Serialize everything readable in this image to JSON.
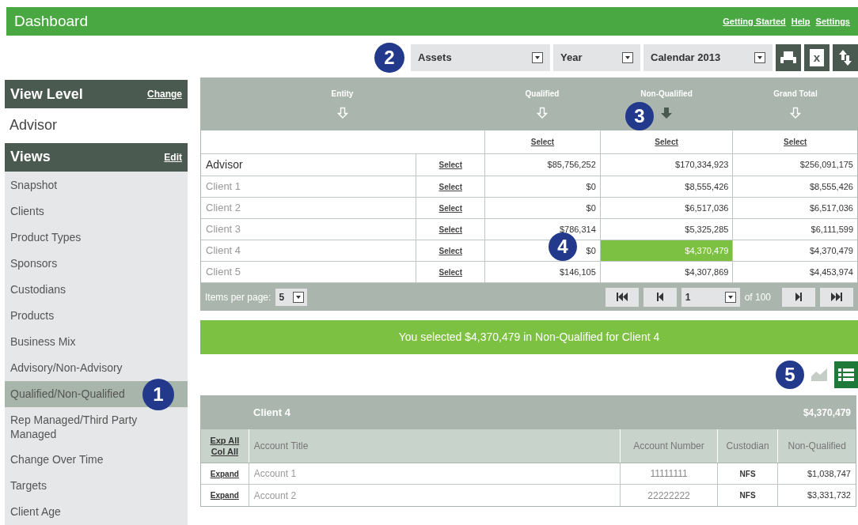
{
  "header": {
    "title": "Dashboard",
    "links": [
      "Getting Started",
      "Help",
      "Settings"
    ]
  },
  "toolbar": {
    "callout": "2",
    "dropdowns": [
      {
        "value": "Assets"
      },
      {
        "value": "Year"
      },
      {
        "value": "Calendar 2013"
      }
    ],
    "buttons": [
      {
        "kind": "print"
      },
      {
        "kind": "excel",
        "label": "x"
      },
      {
        "kind": "sort"
      }
    ]
  },
  "sidebar": {
    "view_level": {
      "title": "View Level",
      "action": "Change",
      "value": "Advisor"
    },
    "views": {
      "title": "Views",
      "action": "Edit",
      "items": [
        {
          "label": "Snapshot",
          "selected": false
        },
        {
          "label": "Clients",
          "selected": false
        },
        {
          "label": "Product Types",
          "selected": false
        },
        {
          "label": "Sponsors",
          "selected": false
        },
        {
          "label": "Custodians",
          "selected": false
        },
        {
          "label": "Products",
          "selected": false
        },
        {
          "label": "Business Mix",
          "selected": false
        },
        {
          "label": "Advisory/Non-Advisory",
          "selected": false
        },
        {
          "label": "Qualified/Non-Qualified",
          "selected": true,
          "callout": "1"
        },
        {
          "label": "Rep Managed/Third Party Managed",
          "selected": false
        },
        {
          "label": "Change Over Time",
          "selected": false
        },
        {
          "label": "Targets",
          "selected": false
        },
        {
          "label": "Client Age",
          "selected": false
        }
      ]
    }
  },
  "summary_table": {
    "columns": [
      {
        "label": "Entity",
        "sorted": false
      },
      {
        "label": "Qualified",
        "sorted": false,
        "select": "Select"
      },
      {
        "label": "Non-Qualified",
        "sorted": true,
        "select": "Select",
        "callout": "3"
      },
      {
        "label": "Grand Total",
        "sorted": false,
        "select": "Select"
      }
    ],
    "rows": [
      {
        "kind": "advisor",
        "entity": "Advisor",
        "select": "Select",
        "values": [
          {
            "text": "$85,756,252",
            "selected": false
          },
          {
            "text": "$170,334,923",
            "selected": false
          },
          {
            "text": "$256,091,175",
            "selected": false
          }
        ]
      },
      {
        "kind": "client",
        "entity": "Client 1",
        "select": "Select",
        "values": [
          {
            "text": "$0",
            "selected": false
          },
          {
            "text": "$8,555,426",
            "selected": false
          },
          {
            "text": "$8,555,426",
            "selected": false
          }
        ]
      },
      {
        "kind": "client",
        "entity": "Client 2",
        "select": "Select",
        "values": [
          {
            "text": "$0",
            "selected": false
          },
          {
            "text": "$6,517,036",
            "selected": false
          },
          {
            "text": "$6,517,036",
            "selected": false
          }
        ]
      },
      {
        "kind": "client",
        "entity": "Client 3",
        "select": "Select",
        "values": [
          {
            "text": "$786,314",
            "selected": false
          },
          {
            "text": "$5,325,285",
            "selected": false
          },
          {
            "text": "$6,111,599",
            "selected": false
          }
        ]
      },
      {
        "kind": "client",
        "entity": "Client 4",
        "select": "Select",
        "values": [
          {
            "text": "$0",
            "selected": false,
            "callout": "4"
          },
          {
            "text": "$4,370,479",
            "selected": true
          },
          {
            "text": "$4,370,479",
            "selected": false
          }
        ]
      },
      {
        "kind": "client",
        "entity": "Client 5",
        "select": "Select",
        "values": [
          {
            "text": "$146,105",
            "selected": false
          },
          {
            "text": "$4,307,869",
            "selected": false
          },
          {
            "text": "$4,453,974",
            "selected": false
          }
        ]
      }
    ],
    "pagination": {
      "items_label": "Items per page:",
      "items_value": "5",
      "page": "1",
      "of": "of 100"
    }
  },
  "selection_banner": "You selected $4,370,479 in Non-Qualified for Client 4",
  "view_toggle": {
    "callout": "5",
    "options": [
      {
        "kind": "chart",
        "selected": false
      },
      {
        "kind": "list",
        "selected": true
      }
    ]
  },
  "detail_table": {
    "title": "Client 4",
    "total": "$4,370,479",
    "expand_all": "Exp All",
    "collapse_all": "Col All",
    "columns": [
      "Account Title",
      "Account Number",
      "Custodian",
      "Non-Qualified"
    ],
    "rows": [
      {
        "action": "Expand",
        "title": "Account 1",
        "number": "11111111",
        "custodian": "NFS",
        "value": "$1,038,747"
      },
      {
        "action": "Expand",
        "title": "Account 2",
        "number": "22222222",
        "custodian": "NFS",
        "value": "$3,331,732"
      }
    ]
  }
}
